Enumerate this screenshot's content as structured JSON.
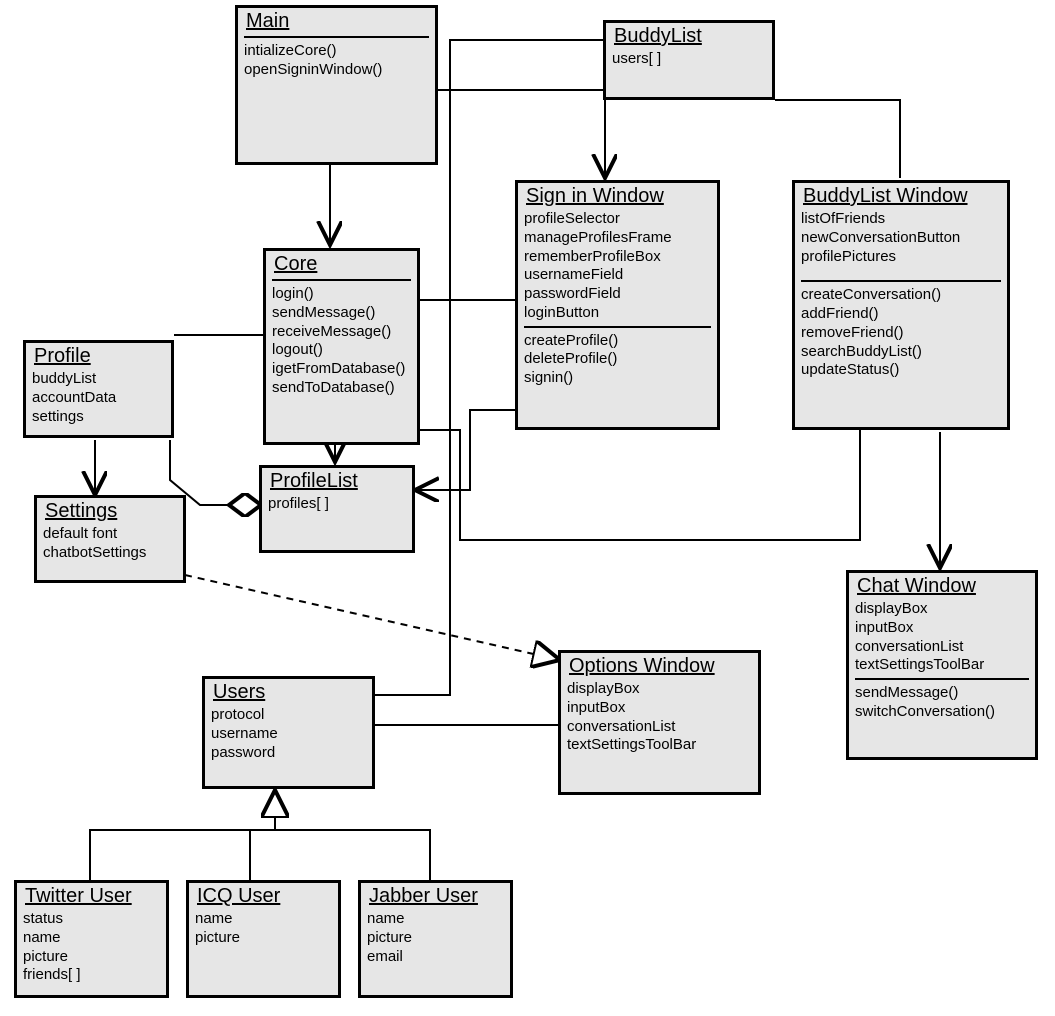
{
  "chart_data": {
    "type": "uml_class_diagram",
    "classes": [
      {
        "id": "Main",
        "name": "Main",
        "attributes": [],
        "operations": [
          "intializeCore()",
          "openSigninWindow()"
        ]
      },
      {
        "id": "BuddyList",
        "name": "BuddyList",
        "attributes": [
          "users[ ]"
        ],
        "operations": []
      },
      {
        "id": "Core",
        "name": "Core",
        "attributes": [],
        "operations": [
          "login()",
          "sendMessage()",
          "receiveMessage()",
          "logout()",
          "igetFromDatabase()",
          "sendToDatabase()"
        ]
      },
      {
        "id": "SignInWindow",
        "name": "Sign in Window",
        "attributes": [
          "profileSelector",
          "manageProfilesFrame",
          "rememberProfileBox",
          "usernameField",
          "passwordField",
          "loginButton"
        ],
        "operations": [
          "createProfile()",
          "deleteProfile()",
          "signin()"
        ]
      },
      {
        "id": "BuddyListWindow",
        "name": "BuddyList Window",
        "attributes": [
          "listOfFriends",
          "newConversationButton",
          "profilePictures"
        ],
        "operations": [
          "createConversation()",
          "addFriend()",
          "removeFriend()",
          "searchBuddyList()",
          "updateStatus()"
        ]
      },
      {
        "id": "Profile",
        "name": "Profile",
        "attributes": [
          "buddyList",
          "accountData",
          "settings"
        ],
        "operations": []
      },
      {
        "id": "ProfileList",
        "name": "ProfileList",
        "attributes": [
          "profiles[ ]"
        ],
        "operations": []
      },
      {
        "id": "Settings",
        "name": "Settings",
        "attributes": [
          "default font",
          "chatbotSettings"
        ],
        "operations": []
      },
      {
        "id": "Users",
        "name": "Users",
        "attributes": [
          "protocol",
          "username",
          "password"
        ],
        "operations": []
      },
      {
        "id": "OptionsWindow",
        "name": "Options Window",
        "attributes": [
          "displayBox",
          "inputBox",
          "conversationList",
          "textSettingsToolBar"
        ],
        "operations": []
      },
      {
        "id": "ChatWindow",
        "name": "Chat Window",
        "attributes": [
          "displayBox",
          "inputBox",
          "conversationList",
          "textSettingsToolBar"
        ],
        "operations": [
          "sendMessage()",
          "switchConversation()"
        ]
      },
      {
        "id": "TwitterUser",
        "name": "Twitter User",
        "attributes": [
          "status",
          "name",
          "picture",
          "friends[ ]"
        ],
        "operations": []
      },
      {
        "id": "ICQUser",
        "name": "ICQ User",
        "attributes": [
          "name",
          "picture"
        ],
        "operations": []
      },
      {
        "id": "JabberUser",
        "name": "Jabber User",
        "attributes": [
          "name",
          "picture",
          "email"
        ],
        "operations": []
      }
    ],
    "relations": [
      {
        "from": "Main",
        "to": "Core",
        "type": "association_directed"
      },
      {
        "from": "Main",
        "to": "SignInWindow",
        "type": "association_directed"
      },
      {
        "from": "BuddyList",
        "to": "BuddyListWindow",
        "type": "association_undirected"
      },
      {
        "from": "Core",
        "to": "SignInWindow",
        "type": "association"
      },
      {
        "from": "Core",
        "to": "ProfileList",
        "type": "association_directed"
      },
      {
        "from": "Core",
        "to": "BuddyListWindow",
        "type": "association"
      },
      {
        "from": "Profile",
        "to": "Core",
        "type": "association"
      },
      {
        "from": "Profile",
        "to": "ProfileList",
        "type": "aggregation"
      },
      {
        "from": "Profile",
        "to": "Settings",
        "type": "association_directed"
      },
      {
        "from": "SignInWindow",
        "to": "ProfileList",
        "type": "association_directed"
      },
      {
        "from": "Settings",
        "to": "OptionsWindow",
        "type": "dependency"
      },
      {
        "from": "Users",
        "to": "BuddyList",
        "type": "aggregation"
      },
      {
        "from": "Users",
        "to": "OptionsWindow",
        "type": "association"
      },
      {
        "from": "BuddyListWindow",
        "to": "ChatWindow",
        "type": "association_directed"
      },
      {
        "from": "TwitterUser",
        "to": "Users",
        "type": "generalization"
      },
      {
        "from": "ICQUser",
        "to": "Users",
        "type": "generalization"
      },
      {
        "from": "JabberUser",
        "to": "Users",
        "type": "generalization"
      }
    ]
  },
  "classes": {
    "Main": {
      "title": "Main",
      "attrs": [],
      "ops": [
        "intializeCore()",
        "openSigninWindow()"
      ]
    },
    "BuddyList": {
      "title": "BuddyList",
      "attrs": [
        "users[ ]"
      ],
      "ops": []
    },
    "Core": {
      "title": "Core",
      "attrs": [],
      "ops": [
        "login()",
        "sendMessage()",
        "receiveMessage()",
        "logout()",
        "igetFromDatabase()",
        "sendToDatabase()"
      ]
    },
    "SignInWindow": {
      "title": "Sign in Window",
      "attrs": [
        "profileSelector",
        "manageProfilesFrame",
        "rememberProfileBox",
        "usernameField",
        "passwordField",
        "loginButton"
      ],
      "ops": [
        "createProfile()",
        "deleteProfile()",
        "signin()"
      ]
    },
    "BuddyListWindow": {
      "title": "BuddyList Window",
      "attrs": [
        "listOfFriends",
        "newConversationButton",
        "profilePictures"
      ],
      "ops": [
        "createConversation()",
        "addFriend()",
        "removeFriend()",
        "searchBuddyList()",
        "updateStatus()"
      ]
    },
    "Profile": {
      "title": "Profile",
      "attrs": [
        "buddyList",
        "accountData",
        "settings"
      ],
      "ops": []
    },
    "ProfileList": {
      "title": "ProfileList",
      "attrs": [
        "profiles[ ]"
      ],
      "ops": []
    },
    "Settings": {
      "title": "Settings",
      "attrs": [
        "default font",
        "chatbotSettings"
      ],
      "ops": []
    },
    "Users": {
      "title": "Users",
      "attrs": [
        "protocol",
        "username",
        "password"
      ],
      "ops": []
    },
    "OptionsWindow": {
      "title": "Options Window",
      "attrs": [
        "displayBox",
        "inputBox",
        "conversationList",
        "textSettingsToolBar"
      ],
      "ops": []
    },
    "ChatWindow": {
      "title": "Chat Window",
      "attrs": [
        "displayBox",
        "inputBox",
        "conversationList",
        "textSettingsToolBar"
      ],
      "ops": [
        "sendMessage()",
        "switchConversation()"
      ]
    },
    "TwitterUser": {
      "title": "Twitter User",
      "attrs": [
        "status",
        "name",
        "picture",
        "friends[ ]"
      ],
      "ops": []
    },
    "ICQUser": {
      "title": "ICQ User",
      "attrs": [
        "name",
        "picture"
      ],
      "ops": []
    },
    "JabberUser": {
      "title": "Jabber User",
      "attrs": [
        "name",
        "picture",
        "email"
      ],
      "ops": []
    }
  }
}
